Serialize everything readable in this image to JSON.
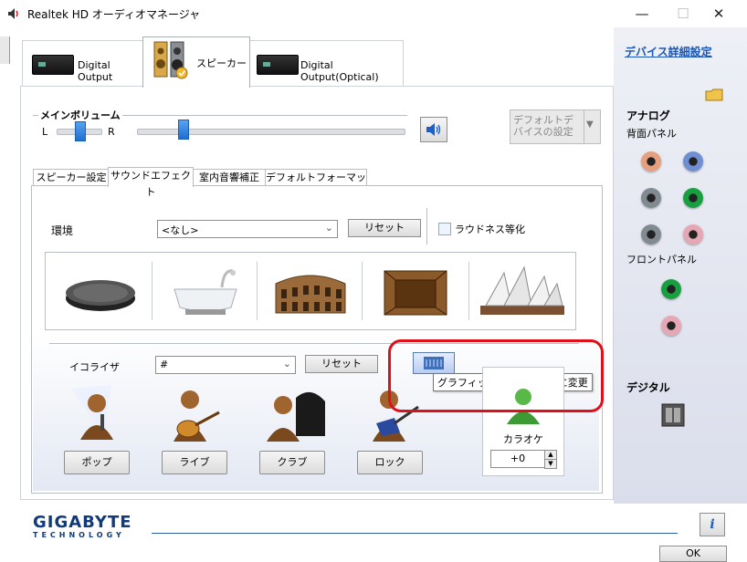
{
  "window": {
    "title": "Realtek HD オーディオマネージャ",
    "minimize_glyph": "—",
    "maximize_glyph": "☐",
    "close_glyph": "✕"
  },
  "device_tabs": [
    {
      "label": "Digital Output"
    },
    {
      "label": "スピーカー"
    },
    {
      "label": "Digital Output(Optical)"
    }
  ],
  "volume": {
    "group_label": "メインボリューム",
    "left_label": "L",
    "right_label": "R",
    "default_device_label": "デフォルトデバイスの設定"
  },
  "inner_tabs": [
    {
      "label": "スピーカー設定"
    },
    {
      "label": "サウンドエフェクト"
    },
    {
      "label": "室内音響補正"
    },
    {
      "label": "デフォルトフォーマット"
    }
  ],
  "environment": {
    "label": "環境",
    "selected": "<なし>",
    "reset_label": "リセット",
    "loudness_label": "ラウドネス等化",
    "loudness_checked": false
  },
  "equalizer": {
    "label": "イコライザ",
    "selected": "#",
    "reset_label": "リセット",
    "graphic_tooltip": "グラフィックイコライザーに変更",
    "presets": [
      {
        "label": "ポップ"
      },
      {
        "label": "ライブ"
      },
      {
        "label": "クラブ"
      },
      {
        "label": "ロック"
      }
    ],
    "karaoke_label": "カラオケ",
    "karaoke_value": "+0"
  },
  "sidebar": {
    "device_settings_link": "デバイス詳細設定",
    "analog_title": "アナログ",
    "rear_panel_label": "背面パネル",
    "front_panel_label": "フロントパネル",
    "digital_title": "デジタル",
    "rear_jack_colors": [
      "#e7a07f",
      "#6f8fd0",
      "#808a90",
      "#18a040",
      "#808a90",
      "#e6a7b4"
    ],
    "front_jack_colors": [
      "#18a040",
      "#e6a7b4"
    ]
  },
  "bottom": {
    "brand_name": "GIGABYTE",
    "brand_sub": "TECHNOLOGY",
    "ok_label": "OK",
    "info_glyph": "i"
  }
}
